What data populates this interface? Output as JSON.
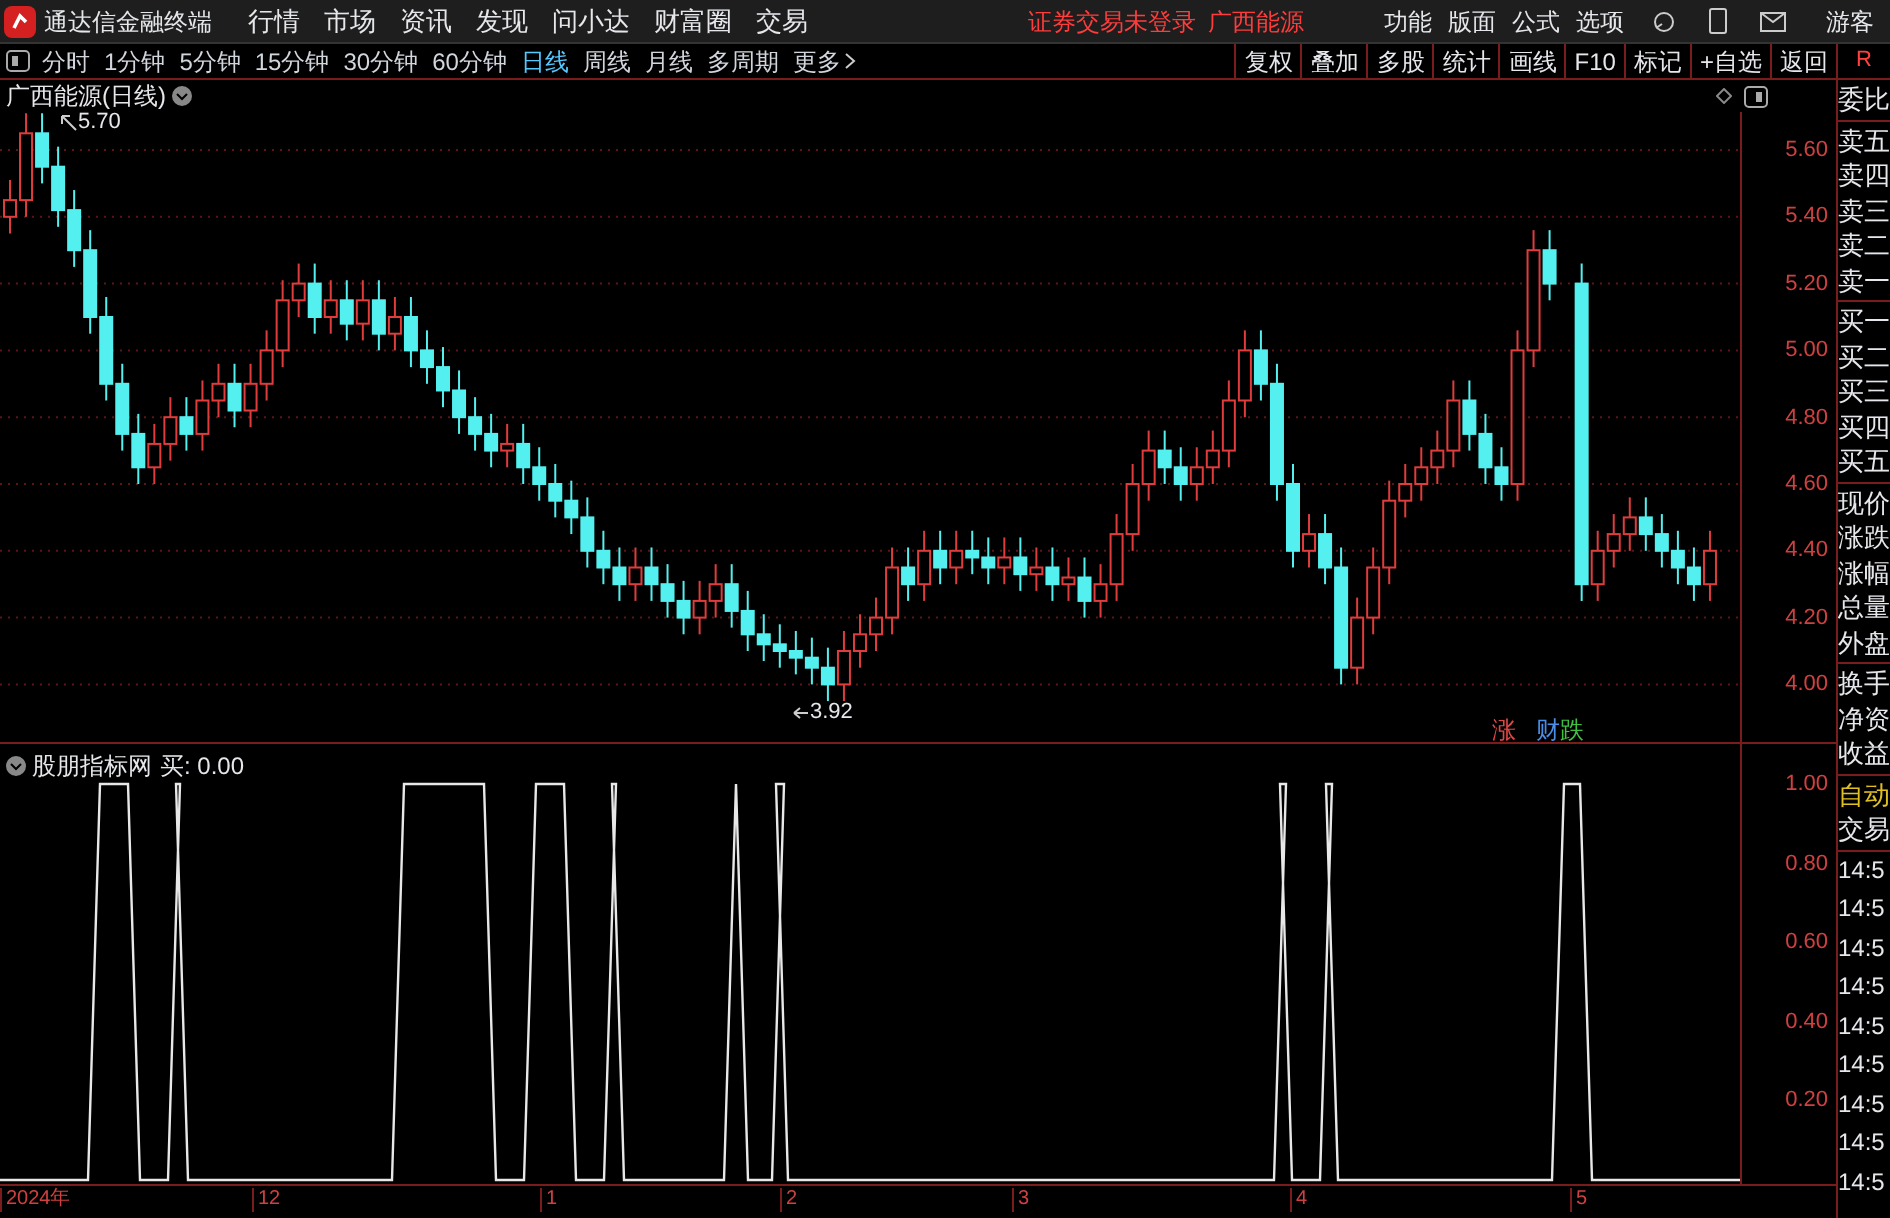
{
  "app": {
    "title": "通达信金融终端"
  },
  "menu": [
    "行情",
    "市场",
    "资讯",
    "发现",
    "问小达",
    "财富圈",
    "交易"
  ],
  "login_status": "证券交易未登录",
  "stock_link": "广西能源",
  "right_menu": [
    "功能",
    "版面",
    "公式",
    "选项"
  ],
  "user": "游客",
  "periods": [
    {
      "label": "分时",
      "selected": false
    },
    {
      "label": "1分钟",
      "selected": false
    },
    {
      "label": "5分钟",
      "selected": false
    },
    {
      "label": "15分钟",
      "selected": false
    },
    {
      "label": "30分钟",
      "selected": false
    },
    {
      "label": "60分钟",
      "selected": false
    },
    {
      "label": "日线",
      "selected": true
    },
    {
      "label": "周线",
      "selected": false
    },
    {
      "label": "月线",
      "selected": false
    },
    {
      "label": "多周期",
      "selected": false
    },
    {
      "label": "更多",
      "selected": false
    }
  ],
  "tools": [
    "复权",
    "叠加",
    "多股",
    "统计",
    "画线",
    "F10",
    "标记",
    "+自选",
    "返回"
  ],
  "panel_tab": "R",
  "chart": {
    "title": "广西能源(日线)",
    "high_label": "5.70",
    "low_label": "3.92",
    "price_axis": [
      "5.60",
      "5.40",
      "5.20",
      "5.00",
      "4.80",
      "4.60",
      "4.40",
      "4.20",
      "4.00"
    ],
    "markers": [
      {
        "label": "涨",
        "color": "#e04848"
      },
      {
        "label": "财",
        "color": "#4a8ee8"
      },
      {
        "label": "跌",
        "color": "#40c040"
      }
    ]
  },
  "indicator": {
    "title": "股朋指标网",
    "reading": "买: 0.00",
    "axis": [
      "1.00",
      "0.80",
      "0.60",
      "0.40",
      "0.20"
    ]
  },
  "date_axis": [
    "2024年",
    "12",
    "1",
    "2",
    "3",
    "4",
    "5"
  ],
  "quote_panel": {
    "sections": [
      [
        {
          "label": "委比",
          "highlighted": false
        }
      ],
      [
        {
          "label": "卖五",
          "highlighted": false
        },
        {
          "label": "卖四",
          "highlighted": false
        },
        {
          "label": "卖三",
          "highlighted": false
        },
        {
          "label": "卖二",
          "highlighted": false
        },
        {
          "label": "卖一",
          "highlighted": false
        }
      ],
      [
        {
          "label": "买一",
          "highlighted": false
        },
        {
          "label": "买二",
          "highlighted": false
        },
        {
          "label": "买三",
          "highlighted": false
        },
        {
          "label": "买四",
          "highlighted": false
        },
        {
          "label": "买五",
          "highlighted": false
        }
      ],
      [
        {
          "label": "现价",
          "highlighted": false
        },
        {
          "label": "涨跌",
          "highlighted": false
        },
        {
          "label": "涨幅",
          "highlighted": false
        },
        {
          "label": "总量",
          "highlighted": false
        },
        {
          "label": "外盘",
          "highlighted": false
        }
      ],
      [
        {
          "label": "换手",
          "highlighted": false
        },
        {
          "label": "净资",
          "highlighted": false
        },
        {
          "label": "收益",
          "highlighted": false
        }
      ],
      [
        {
          "label": "自动",
          "highlighted": true
        },
        {
          "label": "交易",
          "highlighted": false
        }
      ]
    ],
    "times": [
      "14:5",
      "14:5",
      "14:5",
      "14:5",
      "14:5",
      "14:5",
      "14:5",
      "14:5",
      "14:5"
    ]
  }
}
